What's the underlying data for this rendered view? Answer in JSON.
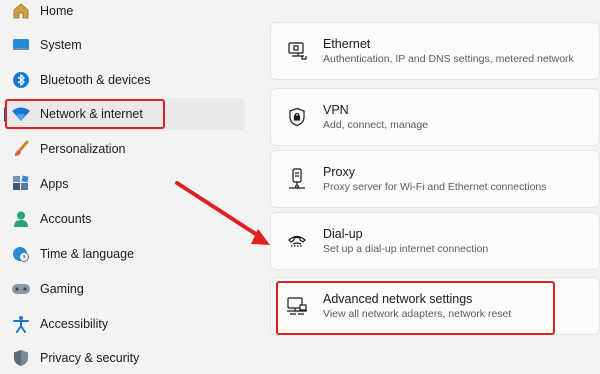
{
  "sidebar": {
    "items": [
      {
        "label": "Home",
        "icon": "home-icon"
      },
      {
        "label": "System",
        "icon": "monitor-icon"
      },
      {
        "label": "Bluetooth & devices",
        "icon": "bluetooth-icon"
      },
      {
        "label": "Network & internet",
        "icon": "wifi-icon",
        "selected": true
      },
      {
        "label": "Personalization",
        "icon": "brush-icon"
      },
      {
        "label": "Apps",
        "icon": "apps-icon"
      },
      {
        "label": "Accounts",
        "icon": "person-icon"
      },
      {
        "label": "Time & language",
        "icon": "globe-clock-icon"
      },
      {
        "label": "Gaming",
        "icon": "gamepad-icon"
      },
      {
        "label": "Accessibility",
        "icon": "accessibility-icon"
      },
      {
        "label": "Privacy & security",
        "icon": "shield-icon"
      }
    ]
  },
  "cards": [
    {
      "title": "Ethernet",
      "desc": "Authentication, IP and DNS settings, metered network",
      "icon": "ethernet-icon"
    },
    {
      "title": "VPN",
      "desc": "Add, connect, manage",
      "icon": "vpn-shield-icon"
    },
    {
      "title": "Proxy",
      "desc": "Proxy server for Wi-Fi and Ethernet connections",
      "icon": "proxy-icon"
    },
    {
      "title": "Dial-up",
      "desc": "Set up a dial-up internet connection",
      "icon": "dialup-icon"
    },
    {
      "title": "Advanced network settings",
      "desc": "View all network adapters, network reset",
      "icon": "advanced-network-icon",
      "highlighted": true
    }
  ],
  "colors": {
    "accent": "#005fb8",
    "annotation": "#e02020"
  }
}
